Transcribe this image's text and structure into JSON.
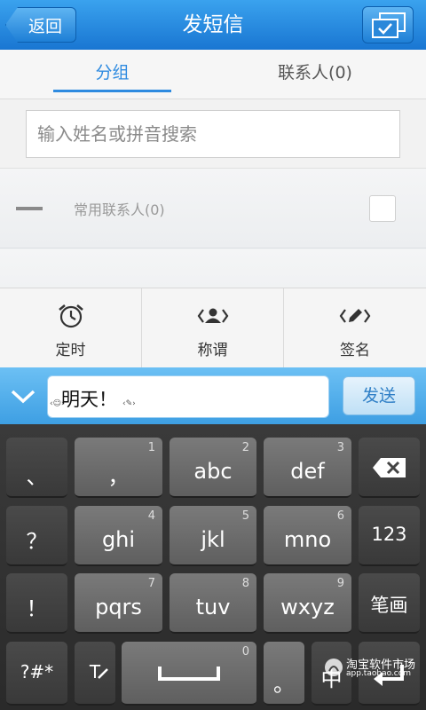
{
  "header": {
    "back_label": "返回",
    "title": "发短信"
  },
  "tabs": [
    {
      "label": "分组"
    },
    {
      "label": "联系人(0)"
    }
  ],
  "search": {
    "placeholder": "输入姓名或拼音搜索"
  },
  "groups": [
    {
      "label": "常用联系人(0)"
    }
  ],
  "tools": [
    {
      "label": "定时",
      "icon": "alarm-clock-icon"
    },
    {
      "label": "称谓",
      "icon": "person-tag-icon"
    },
    {
      "label": "签名",
      "icon": "pen-tag-icon"
    }
  ],
  "compose": {
    "message": "明天！",
    "send_label": "发送"
  },
  "keyboard": {
    "row1": [
      {
        "main": "、",
        "num": ""
      },
      {
        "main": "，",
        "num": "1"
      },
      {
        "main": "abc",
        "num": "2"
      },
      {
        "main": "def",
        "num": "3"
      }
    ],
    "row2": [
      {
        "main": "？",
        "num": ""
      },
      {
        "main": "ghi",
        "num": "4"
      },
      {
        "main": "jkl",
        "num": "5"
      },
      {
        "main": "mno",
        "num": "6"
      },
      {
        "main": "123",
        "num": ""
      }
    ],
    "row3": [
      {
        "main": "！",
        "num": ""
      },
      {
        "main": "pqrs",
        "num": "7"
      },
      {
        "main": "tuv",
        "num": "8"
      },
      {
        "main": "wxyz",
        "num": "9"
      },
      {
        "main": "笔画",
        "num": ""
      }
    ],
    "row4": [
      {
        "main": "?#*",
        "num": ""
      },
      {
        "main": "T",
        "num": ""
      },
      {
        "main": "",
        "num": "0"
      },
      {
        "main": "。",
        "num": ""
      },
      {
        "main": "中",
        "num": ""
      }
    ]
  },
  "watermark": {
    "main": "淘宝软件市场",
    "sub": "app.taobao.com"
  },
  "colors": {
    "accent": "#2f8be0",
    "titlebar": "#1976d2"
  }
}
